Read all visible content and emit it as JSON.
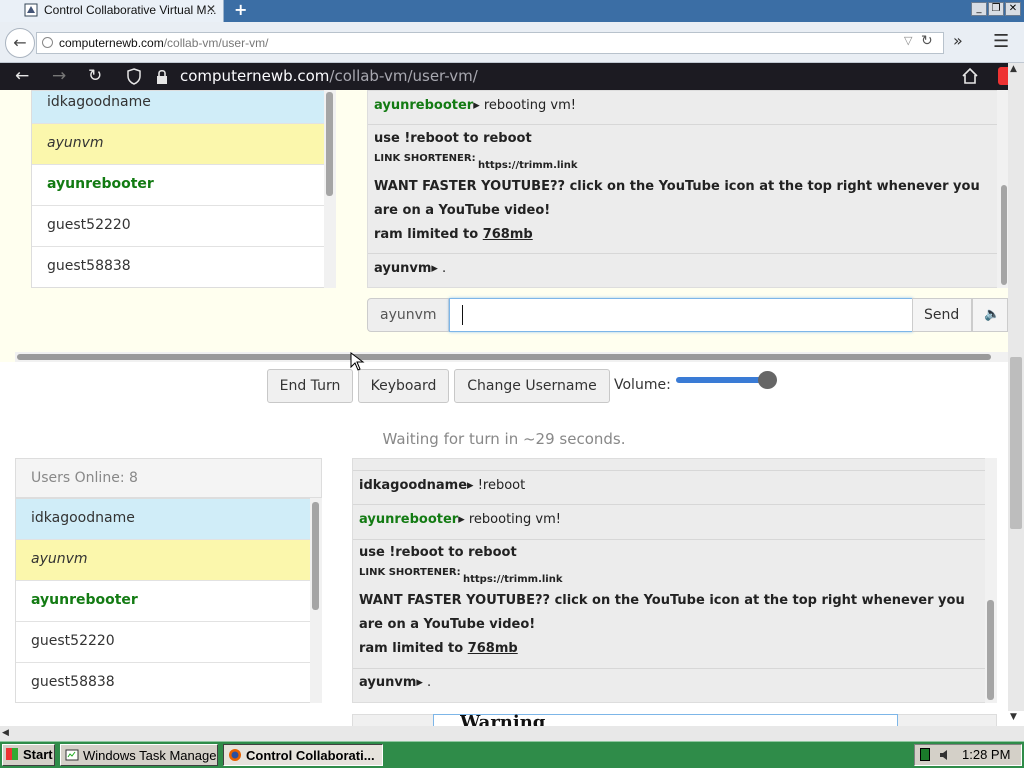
{
  "outer_browser": {
    "tab_title": "Control Collaborative Virtual M...",
    "new_tab": "+",
    "url_host": "computernewb.com",
    "url_path": "/collab-vm/user-vm/"
  },
  "inner_browser": {
    "url_host": "computernewb.com",
    "url_path": "/collab-vm/user-vm/"
  },
  "vm_top": {
    "users": [
      {
        "name": "idkagoodname",
        "style": "blue"
      },
      {
        "name": "ayunvm",
        "style": "yellow"
      },
      {
        "name": "ayunrebooter",
        "style": "green"
      },
      {
        "name": "guest52220",
        "style": "plain"
      },
      {
        "name": "guest58838",
        "style": "plain"
      }
    ],
    "chat": {
      "msg1_user": "ayunrebooter",
      "msg1_text": "▸ rebooting vm!",
      "motd_line1": "use !reboot to reboot",
      "motd_link_label": "LINK SHORTENER:",
      "motd_link": "https://trimm.link",
      "motd_youtube": "WANT FASTER YOUTUBE?? click on the YouTube icon at the top right whenever you",
      "motd_youtube2": "are on a YouTube video!",
      "motd_ram_prefix": "ram limited to ",
      "motd_ram": "768mb",
      "msg2_user": "ayunvm",
      "msg2_text": "▸ ."
    },
    "input_user": "ayunvm",
    "send_label": "Send"
  },
  "controls": {
    "end_turn": "End Turn",
    "keyboard": "Keyboard",
    "change_username": "Change Username",
    "volume_label": "Volume:",
    "volume_level": 0.92
  },
  "waiting_text": "Waiting for turn in ~29 seconds.",
  "vm_bottom": {
    "users_online": "Users Online: 8",
    "users": [
      {
        "name": "idkagoodname",
        "style": "blue"
      },
      {
        "name": "ayunvm",
        "style": "yellow"
      },
      {
        "name": "ayunrebooter",
        "style": "green"
      },
      {
        "name": "guest52220",
        "style": "plain"
      },
      {
        "name": "guest58838",
        "style": "plain"
      }
    ],
    "chat": {
      "msg0_user": "idkagoodname",
      "msg0_text": "▸ !reboot",
      "msg1_user": "ayunrebooter",
      "msg1_text": "▸ rebooting vm!",
      "motd_line1": "use !reboot to reboot",
      "motd_link_label": "LINK SHORTENER:",
      "motd_link": "https://trimm.link",
      "motd_youtube": "WANT FASTER YOUTUBE?? click on the YouTube icon at the top right whenever you",
      "motd_youtube2": "are on a YouTube video!",
      "motd_ram_prefix": "ram limited to ",
      "motd_ram": "768mb",
      "msg2_user": "ayunvm",
      "msg2_text": "▸ ."
    },
    "warning_title": "Warning"
  },
  "taskbar": {
    "start": "Start",
    "task1": "Windows Task Manager",
    "task2": "Control Collaborati...",
    "clock": "1:28 PM"
  }
}
